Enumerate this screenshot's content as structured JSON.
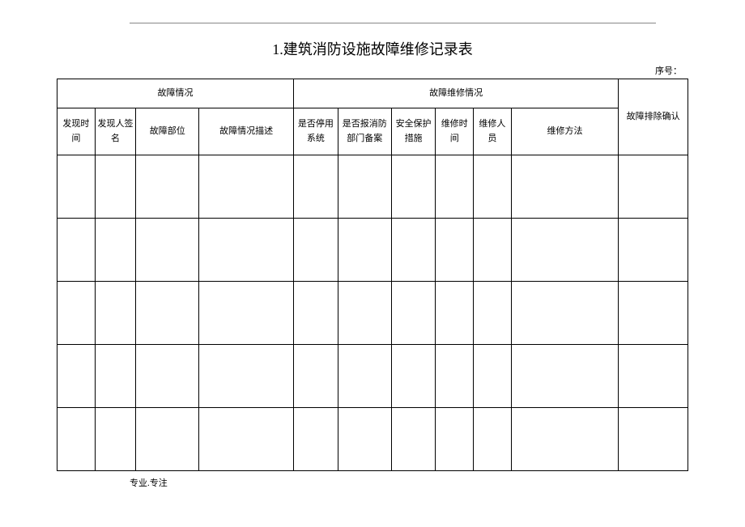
{
  "title": "1.建筑消防设施故障维修记录表",
  "seq_label": "序号：",
  "header": {
    "group1": "故障情况",
    "group2": "故障维修情况",
    "confirm": "故障排除确认",
    "col1": "发现时间",
    "col2": "发现人签名",
    "col3": "故障部位",
    "col4": "故障情况描述",
    "col5": "是否停用系统",
    "col6": "是否报消防部门备案",
    "col7": "安全保护措施",
    "col8": "维修时间",
    "col9": "维修人员",
    "col10": "维修方法"
  },
  "rows": [
    {
      "c1": "",
      "c2": "",
      "c3": "",
      "c4": "",
      "c5": "",
      "c6": "",
      "c7": "",
      "c8": "",
      "c9": "",
      "c10": "",
      "c11": ""
    },
    {
      "c1": "",
      "c2": "",
      "c3": "",
      "c4": "",
      "c5": "",
      "c6": "",
      "c7": "",
      "c8": "",
      "c9": "",
      "c10": "",
      "c11": ""
    },
    {
      "c1": "",
      "c2": "",
      "c3": "",
      "c4": "",
      "c5": "",
      "c6": "",
      "c7": "",
      "c8": "",
      "c9": "",
      "c10": "",
      "c11": ""
    },
    {
      "c1": "",
      "c2": "",
      "c3": "",
      "c4": "",
      "c5": "",
      "c6": "",
      "c7": "",
      "c8": "",
      "c9": "",
      "c10": "",
      "c11": ""
    },
    {
      "c1": "",
      "c2": "",
      "c3": "",
      "c4": "",
      "c5": "",
      "c6": "",
      "c7": "",
      "c8": "",
      "c9": "",
      "c10": "",
      "c11": ""
    }
  ],
  "footer": "专业.专注"
}
